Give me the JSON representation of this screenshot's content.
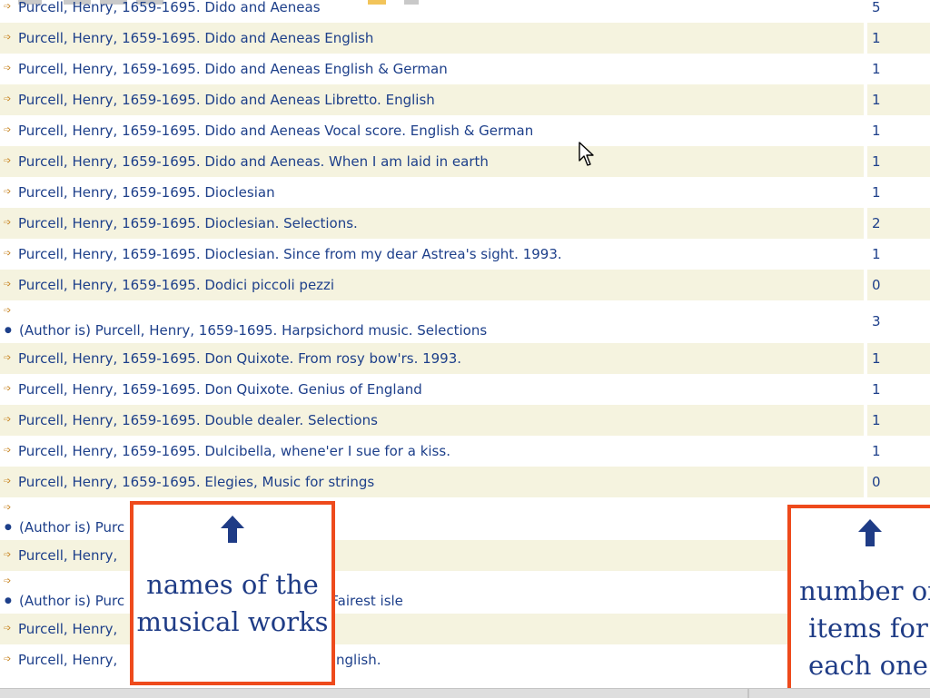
{
  "rows": [
    {
      "title": "Purcell, Henry, 1659-1695. Dido and Aeneas",
      "count": "5",
      "shade": false
    },
    {
      "title": "Purcell, Henry, 1659-1695. Dido and Aeneas English",
      "count": "1",
      "shade": true
    },
    {
      "title": "Purcell, Henry, 1659-1695. Dido and Aeneas English & German",
      "count": "1",
      "shade": false
    },
    {
      "title": "Purcell, Henry, 1659-1695. Dido and Aeneas Libretto. English",
      "count": "1",
      "shade": true
    },
    {
      "title": "Purcell, Henry, 1659-1695. Dido and Aeneas Vocal score. English & German",
      "count": "1",
      "shade": false
    },
    {
      "title": "Purcell, Henry, 1659-1695. Dido and Aeneas. When I am laid in earth",
      "count": "1",
      "shade": true
    },
    {
      "title": "Purcell, Henry, 1659-1695. Dioclesian",
      "count": "1",
      "shade": false
    },
    {
      "title": "Purcell, Henry, 1659-1695. Dioclesian. Selections.",
      "count": "2",
      "shade": true
    },
    {
      "title": "Purcell, Henry, 1659-1695. Dioclesian. Since from my dear Astrea's sight. 1993.",
      "count": "1",
      "shade": false
    },
    {
      "title": "Purcell, Henry, 1659-1695. Dodici piccoli pezzi",
      "count": "0",
      "shade": true
    },
    {
      "author": "(Author is) Purcell, Henry, 1659-1695. Harpsichord music. Selections",
      "count": "3",
      "shade": false
    },
    {
      "title": "Purcell, Henry, 1659-1695. Don Quixote. From rosy bow'rs. 1993.",
      "count": "1",
      "shade": true
    },
    {
      "title": "Purcell, Henry, 1659-1695. Don Quixote. Genius of England",
      "count": "1",
      "shade": false
    },
    {
      "title": "Purcell, Henry, 1659-1695. Double dealer. Selections",
      "count": "1",
      "shade": true
    },
    {
      "title": "Purcell, Henry, 1659-1695. Dulcibella, whene'er I sue for a kiss.",
      "count": "1",
      "shade": false
    },
    {
      "title": "Purcell, Henry, 1659-1695. Elegies, Music for strings",
      "count": "0",
      "shade": true
    },
    {
      "author": "(Author is) Purc                                    ctions",
      "count": "",
      "shade": false
    },
    {
      "title": "Purcell, Henry,",
      "count": "",
      "shade": true
    },
    {
      "author": "(Author is) Purc                                    Arthur. Fairest isle",
      "count": "",
      "shade": false
    },
    {
      "title": "Purcell, Henry,",
      "count": "",
      "shade": true
    },
    {
      "title": "Purcell, Henry,                                       retto. English.",
      "count": "",
      "shade": false
    }
  ],
  "callouts": {
    "left": {
      "line1": "names of the",
      "line2": "musical works"
    },
    "right": {
      "line1": "number of",
      "line2": "items for",
      "line3": "each one"
    }
  },
  "icons": {
    "row_arrow": "arrow-right-icon",
    "up_arrow": "arrow-up-icon",
    "cursor": "mouse-cursor-icon"
  },
  "colors": {
    "link": "#1d3f8a",
    "shade": "#f5f3df",
    "callout_border": "#ee4a1c",
    "callout_text": "#1f3c86",
    "arrow": "#c7821e"
  }
}
